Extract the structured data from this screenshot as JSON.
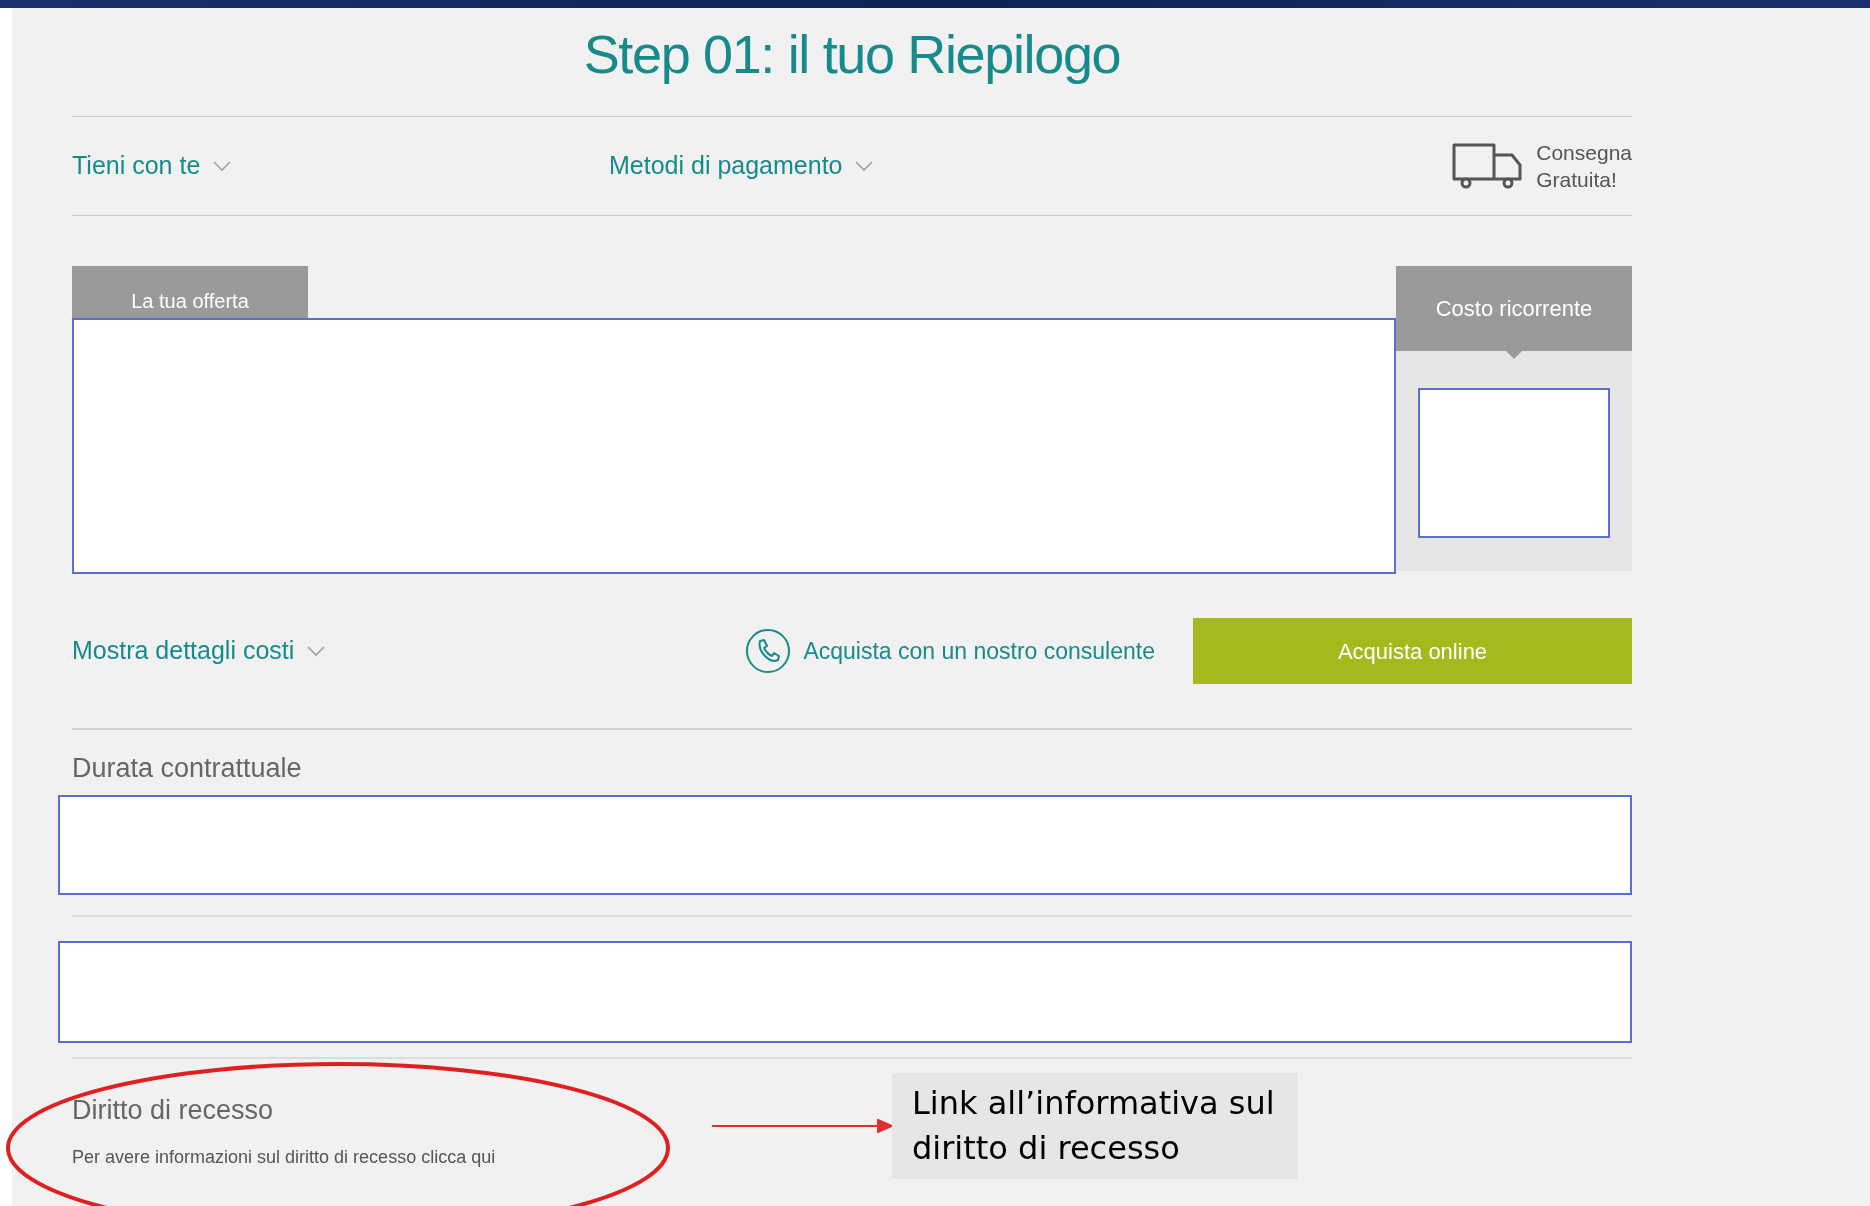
{
  "page": {
    "title": "Step 01: il tuo Riepilogo",
    "options": [
      {
        "label": "Tieni con te",
        "expanded": false
      },
      {
        "label": "Metodi di pagamento",
        "expanded": false
      }
    ],
    "delivery": [
      "Consegna",
      "Gratuita!"
    ],
    "offer_tab": "La tua offerta",
    "recurring_tab": "Costo ricorrente",
    "cost_details": {
      "label": "Mostra dettagli costi",
      "expanded": false
    },
    "consultant_link": "Acquista con un nostro consulente",
    "buy_button": "Acquista online",
    "duration_label": "Durata contrattuale",
    "withdrawal": {
      "title": "Diritto di recesso",
      "text": "Per avere informazioni sul diritto di recesso clicca qui"
    }
  },
  "annotation": {
    "text": "Link all’informativa sul diritto di recesso"
  }
}
